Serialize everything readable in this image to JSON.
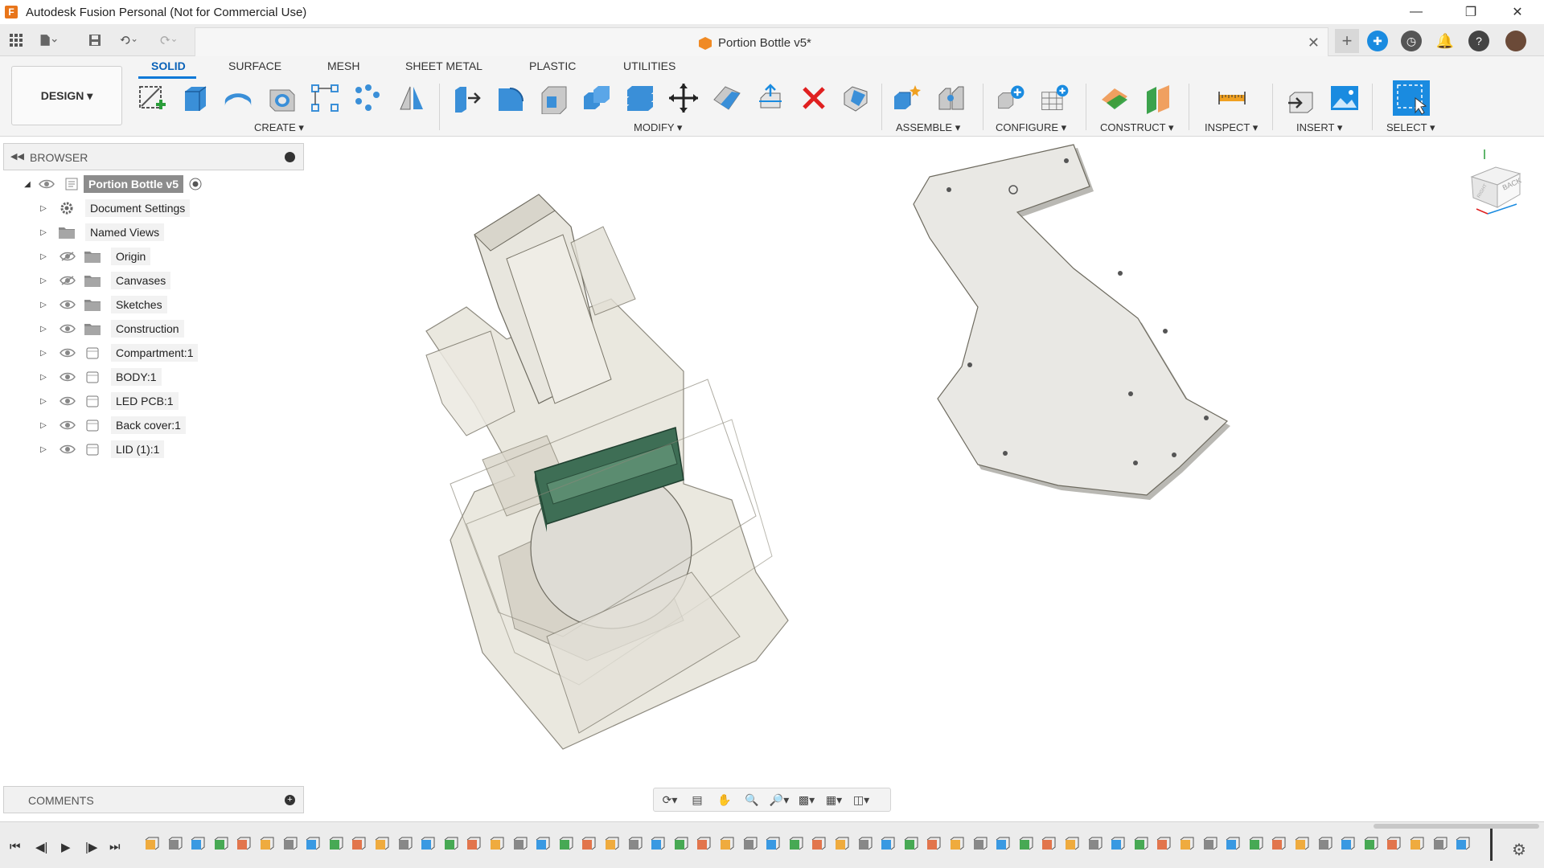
{
  "window": {
    "title": "Autodesk Fusion Personal (Not for Commercial Use)"
  },
  "document": {
    "title": "Portion Bottle v5*"
  },
  "ribbon": {
    "workspace": "DESIGN ▾",
    "tabs": [
      "SOLID",
      "SURFACE",
      "MESH",
      "SHEET METAL",
      "PLASTIC",
      "UTILITIES"
    ],
    "active_tab": "SOLID",
    "groups": [
      "CREATE ▾",
      "MODIFY ▾",
      "ASSEMBLE ▾",
      "CONFIGURE ▾",
      "CONSTRUCT ▾",
      "INSPECT ▾",
      "INSERT ▾",
      "SELECT ▾"
    ]
  },
  "browser": {
    "title": "BROWSER",
    "root": "Portion Bottle v5",
    "items": [
      {
        "label": "Document Settings",
        "icon": "gear-icon"
      },
      {
        "label": "Named Views",
        "icon": "folder-icon"
      },
      {
        "label": "Origin",
        "icon": "folder-icon",
        "hidden": true
      },
      {
        "label": "Canvases",
        "icon": "folder-icon",
        "hidden": true
      },
      {
        "label": "Sketches",
        "icon": "folder-icon"
      },
      {
        "label": "Construction",
        "icon": "folder-icon"
      },
      {
        "label": "Compartment:1",
        "icon": "component-icon"
      },
      {
        "label": "BODY:1",
        "icon": "component-icon"
      },
      {
        "label": "LED PCB:1",
        "icon": "component-icon"
      },
      {
        "label": "Back cover:1",
        "icon": "component-icon"
      },
      {
        "label": "LID (1):1",
        "icon": "component-icon"
      }
    ]
  },
  "comments": {
    "title": "COMMENTS"
  },
  "viewcube": {
    "face_back": "BACK",
    "face_right": "RIGHT"
  },
  "colors": {
    "accent": "#0a78d7",
    "select_blue": "#1a8be0",
    "pcb_green": "#3e6e55",
    "model_gray": "#e6e4dc"
  }
}
